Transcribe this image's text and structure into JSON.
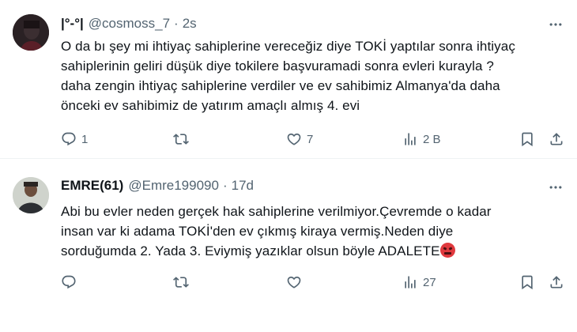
{
  "tweets": [
    {
      "display_name": "|°-°|",
      "handle": "@cosmoss_7",
      "separator": "·",
      "time": "2s",
      "text": "O da bı şey mi ihtiyaç sahiplerine vereceğiz diye TOKİ yaptılar sonra ihtiyaç\nsahiplerinin geliri düşük diye tokilere başvuramadi sonra evleri kurayla ?\ndaha zengin ihtiyaç sahiplerine verdiler ve ev sahibimiz Almanya'da daha\nönceki ev sahibimiz de yatırım amaçlı almış 4. evi",
      "reply_count": "1",
      "retweet_count": "",
      "like_count": "7",
      "view_count": "2 B"
    },
    {
      "display_name": "EMRE(61)",
      "handle": "@Emre199090",
      "separator": "·",
      "time": "17d",
      "text": "Abi bu evler neden gerçek hak sahiplerine verilmiyor.Çevremde o kadar\ninsan var ki adama TOKİ'den ev çıkmış kiraya vermiş.Neden diye\nsorduğumda 2. Yada 3. Eviymiş yazıklar olsun böyle ADALETE",
      "emoji": "angry-face",
      "reply_count": "",
      "retweet_count": "",
      "like_count": "",
      "view_count": "27"
    }
  ],
  "colors": {
    "text_primary": "#0f1419",
    "text_secondary": "#536471",
    "divider": "#eff3f4"
  }
}
